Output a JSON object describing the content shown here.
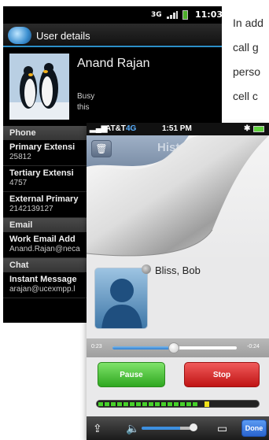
{
  "article": {
    "lines": [
      "In add",
      "call g",
      "perso",
      "cell c"
    ]
  },
  "android": {
    "status_bar": {
      "network": "3G",
      "time": "11:03"
    },
    "title": "User details",
    "profile": {
      "name": "Anand Rajan",
      "status_line1": "Busy",
      "status_line2": "this"
    },
    "sections": [
      {
        "header": "Phone",
        "rows": [
          {
            "label": "Primary Extensi",
            "value": "25812"
          },
          {
            "label": "Tertiary Extensi",
            "value": "4757"
          },
          {
            "label": "External Primary",
            "value": "2142139127"
          }
        ]
      },
      {
        "header": "Email",
        "rows": [
          {
            "label": "Work Email Add",
            "value": "Anand.Rajan@neca"
          }
        ]
      },
      {
        "header": "Chat",
        "rows": [
          {
            "label": "Instant Message",
            "value": "arajan@ucexmpp.l"
          }
        ]
      }
    ]
  },
  "iphone": {
    "status_bar": {
      "carrier": "AT&T",
      "network": "4G",
      "time": "1:51 PM"
    },
    "header_title": "Histo",
    "contact_name": "Bliss, Bob",
    "seek": {
      "elapsed": "0:23",
      "remaining": "-0:24",
      "progress": 0.49
    },
    "buttons": {
      "pause": "Pause",
      "stop": "Stop",
      "done": "Done"
    },
    "level_meter": {
      "level": 0.62,
      "peak": 0.66
    },
    "volume": 0.7,
    "colors": {
      "pause": "#2fa720",
      "stop": "#c01414",
      "accent": "#2c8fc7"
    }
  }
}
